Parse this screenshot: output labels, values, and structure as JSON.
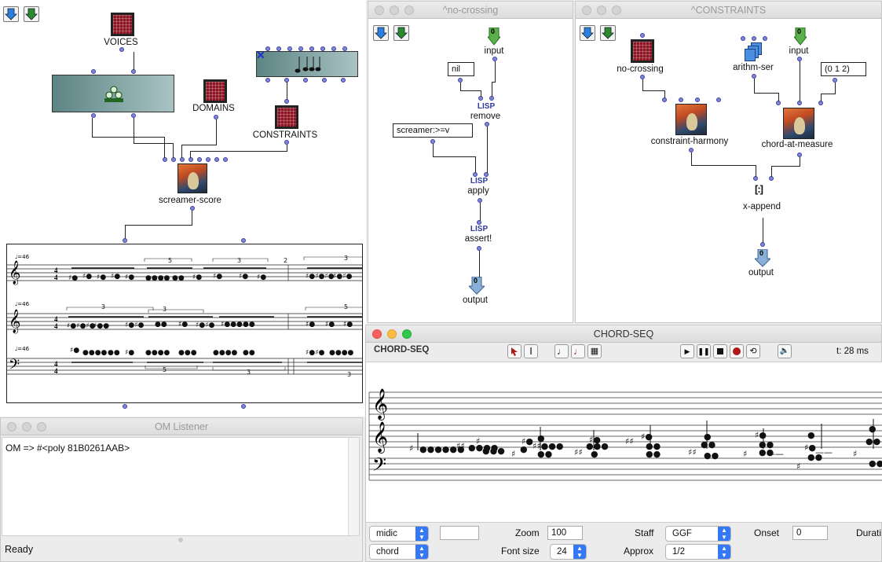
{
  "main_patch": {
    "boxes": {
      "voices": "VOICES",
      "domains": "DOMAINS",
      "constraints": "CONSTRAINTS",
      "screamer_score": "screamer-score"
    },
    "score": {
      "tempo": "♩=46",
      "tuplets": [
        "5",
        "3",
        "2",
        "3",
        "3",
        "3",
        "5",
        "3",
        "5",
        "3"
      ],
      "time_sig": "4/4"
    }
  },
  "no_crossing_window": {
    "title": "^no-crossing",
    "input_label": "input",
    "input_index": "0",
    "nil_value": "nil",
    "remove_label": "remove",
    "screamer_value": "screamer:>=v",
    "apply_label": "apply",
    "assert_label": "assert!",
    "output_label": "output",
    "output_index": "0",
    "lisp_tag": "LISP"
  },
  "constraints_window": {
    "title": "^CONSTRAINTS",
    "no_crossing_label": "no-crossing",
    "arithm_label": "arithm-ser",
    "input_label": "input",
    "input_index": "0",
    "list_value": "(0 1 2)",
    "constraint_harmony_label": "constraint-harmony",
    "chord_at_measure_label": "chord-at-measure",
    "x_append_label": "x-append",
    "output_label": "output",
    "output_index": "0"
  },
  "chord_seq_window": {
    "title": "CHORD-SEQ",
    "editor_name": "CHORD-SEQ",
    "time_readout": "t: 28 ms",
    "controls": {
      "midic": "midic",
      "chord": "chord",
      "zoom_label": "Zoom",
      "zoom_value": "100",
      "font_size_label": "Font size",
      "font_size_value": "24",
      "staff_label": "Staff",
      "staff_value": "GGF",
      "approx_label": "Approx",
      "approx_value": "1/2",
      "onset_label": "Onset",
      "onset_value": "0",
      "duration_label": "Durati"
    }
  },
  "listener_window": {
    "title": "OM Listener",
    "output_text": "OM => #<poly 81B0261AAB>",
    "status": "Ready"
  },
  "colors": {
    "pin_fill": "#7f86d6",
    "arrow_blue": "#2a7fe0",
    "arrow_green": "#2c8a2c",
    "grid_icon": "#8d1422",
    "lisp_blue": "#2d3aa0"
  }
}
